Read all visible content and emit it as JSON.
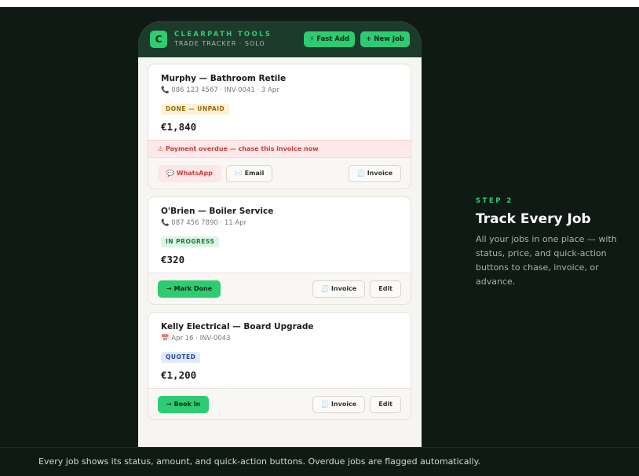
{
  "app": {
    "brand_name": "CLEARPATH TOOLS",
    "brand_sub": "TRADE TRACKER · SOLO",
    "logo_letter": "C",
    "fast_add_label": "⚡ Fast Add",
    "new_job_label": "+ New Job"
  },
  "jobs": [
    {
      "title": "Murphy — Bathroom Retile",
      "meta": "📞 086 123 4567 · INV-0041 · 3 Apr",
      "status": "DONE — UNPAID",
      "amount": "€1,840",
      "alert": "⚠ Payment overdue — chase this invoice now",
      "actions": {
        "whatsapp": "💬 WhatsApp",
        "email": "✉️ Email",
        "invoice": "🧾 Invoice"
      }
    },
    {
      "title": "O'Brien — Boiler Service",
      "meta": "📞 087 456 7890 · 11 Apr",
      "status": "IN PROGRESS",
      "amount": "€320",
      "actions": {
        "primary": "→ Mark Done",
        "invoice": "🧾 Invoice",
        "edit": "Edit"
      }
    },
    {
      "title": "Kelly Electrical — Board Upgrade",
      "meta": "📅 Apr 16 · INV-0043",
      "status": "QUOTED",
      "amount": "€1,200",
      "actions": {
        "primary": "→ Book In",
        "invoice": "🧾 Invoice",
        "edit": "Edit"
      }
    }
  ],
  "step": {
    "label": "STEP 2",
    "title": "Track Every Job",
    "description": "All your jobs in one place — with status, price, and quick-action buttons to chase, invoice, or advance."
  },
  "caption": "Every job shows its status, amount, and quick-action buttons. Overdue jobs are flagged automatically.",
  "colors": {
    "accent": "#2ecc71",
    "background": "#101a15",
    "header": "#1d3b2b",
    "alert": "#d23939"
  }
}
